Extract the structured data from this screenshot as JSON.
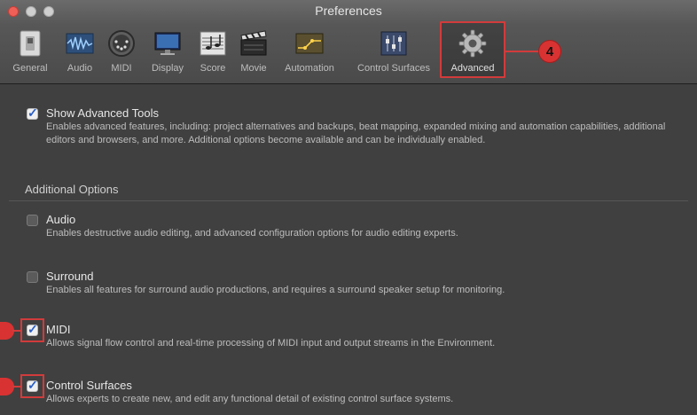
{
  "window": {
    "title": "Preferences"
  },
  "tabs": [
    {
      "id": "general",
      "label": "General",
      "icon": "switch-icon"
    },
    {
      "id": "audio",
      "label": "Audio",
      "icon": "waveform-icon"
    },
    {
      "id": "midi",
      "label": "MIDI",
      "icon": "midi-connector-icon"
    },
    {
      "id": "display",
      "label": "Display",
      "icon": "monitor-icon"
    },
    {
      "id": "score",
      "label": "Score",
      "icon": "score-notes-icon"
    },
    {
      "id": "movie",
      "label": "Movie",
      "icon": "clapperboard-icon"
    },
    {
      "id": "automation",
      "label": "Automation",
      "icon": "automation-curve-icon"
    },
    {
      "id": "control_surfaces",
      "label": "Control Surfaces",
      "icon": "fader-icon"
    },
    {
      "id": "advanced",
      "label": "Advanced",
      "icon": "gear-icon",
      "selected": true
    }
  ],
  "callouts": {
    "tab_badge": "4"
  },
  "show_advanced": {
    "title": "Show Advanced Tools",
    "checked": true,
    "desc": "Enables advanced features, including: project alternatives and backups, beat mapping, expanded mixing and automation capabilities, additional editors and browsers, and more. Additional options become available and can be individually enabled."
  },
  "additional": {
    "title": "Additional Options",
    "options": [
      {
        "id": "audio",
        "title": "Audio",
        "checked": false,
        "desc": "Enables destructive audio editing, and advanced configuration options for audio editing experts."
      },
      {
        "id": "surround",
        "title": "Surround",
        "checked": false,
        "desc": "Enables all features for surround audio productions, and requires a surround speaker setup for monitoring."
      },
      {
        "id": "midi",
        "title": "MIDI",
        "checked": true,
        "desc": "Allows signal flow control and real-time processing of MIDI input and output streams in the Environment."
      },
      {
        "id": "control_surfaces",
        "title": "Control Surfaces",
        "checked": true,
        "desc": "Allows experts to create new, and edit any functional detail of existing control surface systems."
      }
    ]
  },
  "colors": {
    "accent_red": "#d23b3b",
    "checkbox_check": "#2b5fc5",
    "background": "#404040"
  }
}
